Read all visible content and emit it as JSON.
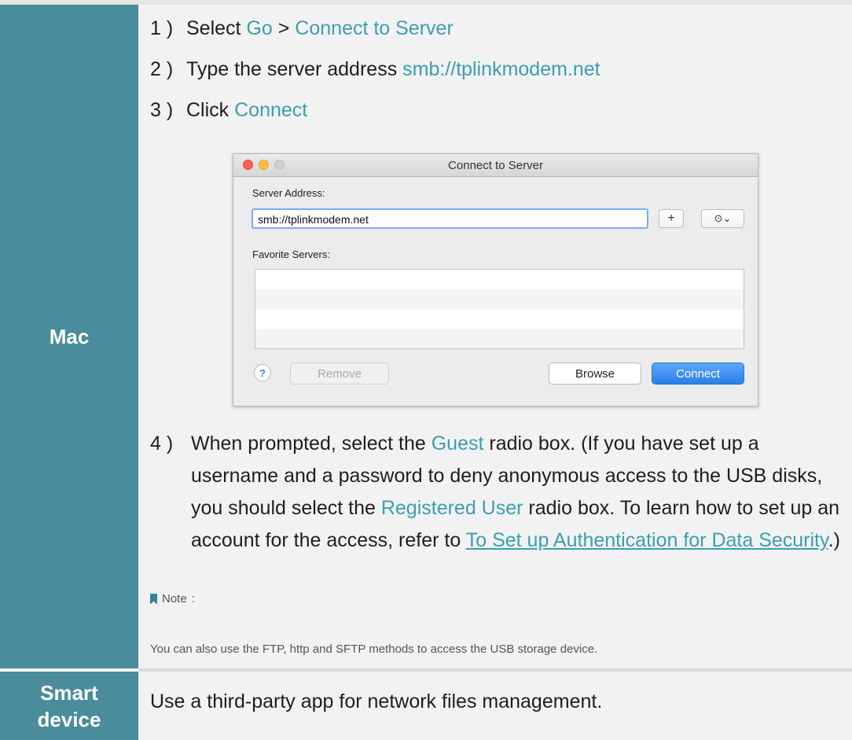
{
  "rows": {
    "mac": {
      "label": "Mac"
    },
    "smart": {
      "label_line1": "Smart",
      "label_line2": "device",
      "text": "Use a third-party app for network files management."
    }
  },
  "steps": {
    "s1": {
      "num": "1 )",
      "text": "Select ",
      "hl1": "Go",
      "mid": " > ",
      "hl2": "Connect to Server"
    },
    "s2": {
      "num": "2 )",
      "text": "Type the server address ",
      "hl": "smb://tplinkmodem.net"
    },
    "s3": {
      "num": "3 )",
      "text": "Click ",
      "hl": "Connect"
    },
    "s4": {
      "num": "4 )",
      "p1": "When prompted, select the ",
      "hl1": "Guest",
      "p2": " radio box. (If you have set up a username and a password to deny anonymous access to the USB disks, you should select the ",
      "hl2": "Registered User",
      "p3": " radio box. To learn how to set up an account for the access, refer to ",
      "link": "To Set up Authentication for Data Security",
      "p4": ".)"
    }
  },
  "note": {
    "label": "Note",
    "colon": ":",
    "text": "You can also use the FTP, http and SFTP methods to access the USB storage device."
  },
  "dialog": {
    "title": "Connect to Server",
    "server_address_label": "Server Address:",
    "server_address_value": "smb://tplinkmodem.net",
    "add_symbol": "+",
    "history_symbol": "⊙⌄",
    "favorites_label": "Favorite Servers:",
    "help_symbol": "?",
    "remove_label": "Remove",
    "browse_label": "Browse",
    "connect_label": "Connect"
  },
  "colors": {
    "label_bg": "#4a8c9b",
    "content_bg": "#f2f2f2",
    "highlight": "#3a9fb0"
  }
}
